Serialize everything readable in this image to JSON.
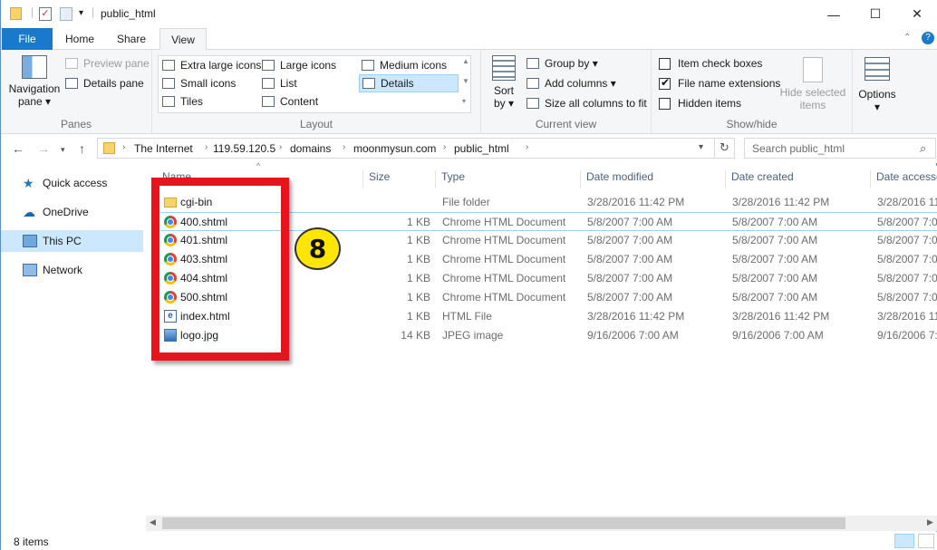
{
  "window": {
    "title": "public_html",
    "minimize": "—",
    "maximize": "☐",
    "close": "✕"
  },
  "tabs": {
    "file": "File",
    "home": "Home",
    "share": "Share",
    "view": "View"
  },
  "ribbon": {
    "panes": {
      "label": "Panes",
      "navigation_pane": "Navigation",
      "navigation_pane2": "pane ▾",
      "preview_pane": "Preview pane",
      "details_pane": "Details pane"
    },
    "layout": {
      "label": "Layout",
      "items": [
        "Extra large icons",
        "Large icons",
        "Medium icons",
        "Small icons",
        "List",
        "Details",
        "Tiles",
        "Content"
      ]
    },
    "current_view": {
      "label": "Current view",
      "sort_by": "Sort",
      "sort_by2": "by ▾",
      "group_by": "Group by ▾",
      "add_columns": "Add columns ▾",
      "size_all_columns": "Size all columns to fit"
    },
    "show_hide": {
      "label": "Show/hide",
      "item_check_boxes": "Item check boxes",
      "file_name_extensions": "File name extensions",
      "hidden_items": "Hidden items",
      "hide_selected": "Hide selected",
      "hide_selected2": "items"
    },
    "options": {
      "label": "Options",
      "arrow": "▾"
    }
  },
  "address": {
    "crumbs": [
      "The Internet",
      "119.59.120.5",
      "domains",
      "moonmysun.com",
      "public_html"
    ],
    "search_placeholder": "Search public_html"
  },
  "sidebar": {
    "items": [
      "Quick access",
      "OneDrive",
      "This PC",
      "Network"
    ]
  },
  "columns": {
    "name": "Name",
    "size": "Size",
    "type": "Type",
    "date_modified": "Date modified",
    "date_created": "Date created",
    "date_accessed": "Date accesse"
  },
  "files": [
    {
      "name": "cgi-bin",
      "size": "",
      "type": "File folder",
      "modified": "3/28/2016 11:42 PM",
      "created": "3/28/2016 11:42 PM",
      "accessed": "3/28/2016 11",
      "icon": "folder-icon"
    },
    {
      "name": "400.shtml",
      "size": "1 KB",
      "type": "Chrome HTML Document",
      "modified": "5/8/2007 7:00 AM",
      "created": "5/8/2007 7:00 AM",
      "accessed": "5/8/2007 7:0",
      "icon": "chrome-icon"
    },
    {
      "name": "401.shtml",
      "size": "1 KB",
      "type": "Chrome HTML Document",
      "modified": "5/8/2007 7:00 AM",
      "created": "5/8/2007 7:00 AM",
      "accessed": "5/8/2007 7:0",
      "icon": "chrome-icon"
    },
    {
      "name": "403.shtml",
      "size": "1 KB",
      "type": "Chrome HTML Document",
      "modified": "5/8/2007 7:00 AM",
      "created": "5/8/2007 7:00 AM",
      "accessed": "5/8/2007 7:0",
      "icon": "chrome-icon"
    },
    {
      "name": "404.shtml",
      "size": "1 KB",
      "type": "Chrome HTML Document",
      "modified": "5/8/2007 7:00 AM",
      "created": "5/8/2007 7:00 AM",
      "accessed": "5/8/2007 7:0",
      "icon": "chrome-icon"
    },
    {
      "name": "500.shtml",
      "size": "1 KB",
      "type": "Chrome HTML Document",
      "modified": "5/8/2007 7:00 AM",
      "created": "5/8/2007 7:00 AM",
      "accessed": "5/8/2007 7:0",
      "icon": "chrome-icon"
    },
    {
      "name": "index.html",
      "size": "1 KB",
      "type": "HTML File",
      "modified": "3/28/2016 11:42 PM",
      "created": "3/28/2016 11:42 PM",
      "accessed": "3/28/2016 11",
      "icon": "html-file-icon"
    },
    {
      "name": "logo.jpg",
      "size": "14 KB",
      "type": "JPEG image",
      "modified": "9/16/2006 7:00 AM",
      "created": "9/16/2006 7:00 AM",
      "accessed": "9/16/2006 7:0",
      "icon": "jpeg-image-icon"
    }
  ],
  "annotation": {
    "badge": "8",
    "color": "#e8141b",
    "badge_color": "#ffe600"
  },
  "status": {
    "items": "8 items"
  },
  "colors": {
    "accent": "#1979ca",
    "selected_nav": "#cce8ff"
  }
}
